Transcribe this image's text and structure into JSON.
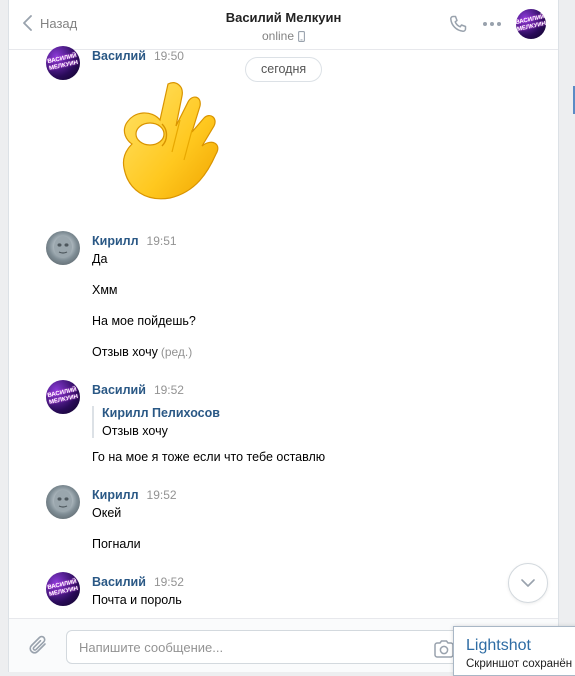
{
  "header": {
    "back_label": "Назад",
    "title": "Василий Мелкуин",
    "status": "online",
    "avatar_text": "ВАСИЛИЙ МЕЛКУИН"
  },
  "date_divider": "сегодня",
  "messages": [
    {
      "author": "Василий",
      "time": "19:50",
      "sticker": "ok-hand-emoji"
    },
    {
      "author": "Кирилл",
      "time": "19:51",
      "lines": [
        "Да",
        "Хмм",
        "На мое пойдешь?",
        "Отзыв хочу"
      ],
      "edited_label": "(ред.)"
    },
    {
      "author": "Василий",
      "time": "19:52",
      "quote": {
        "name": "Кирилл Пелихосов",
        "text": "Отзыв хочу"
      },
      "lines": [
        "Го на мое я тоже если что тебе оставлю"
      ]
    },
    {
      "author": "Кирилл",
      "time": "19:52",
      "lines": [
        "Окей",
        "Погнали"
      ]
    },
    {
      "author": "Василий",
      "time": "19:52",
      "lines": [
        "Почта и пороль"
      ]
    }
  ],
  "composer": {
    "placeholder": "Напишите сообщение..."
  },
  "lightshot": {
    "title": "Lightshot",
    "subtitle": "Скриншот сохранён"
  },
  "colors": {
    "link": "#2a5885",
    "muted": "#939393",
    "accent": "#5181b8"
  }
}
